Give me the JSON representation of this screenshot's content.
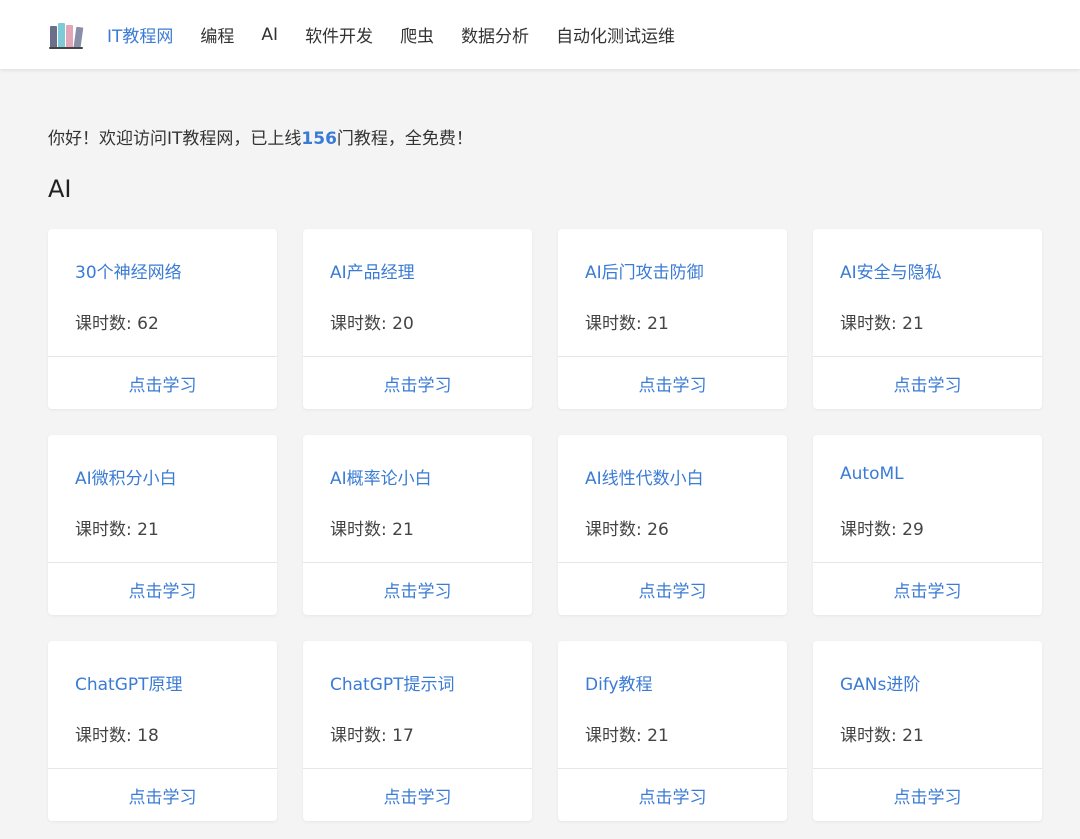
{
  "nav": {
    "logo_icon": "books-icon",
    "items": [
      {
        "label": "IT教程网",
        "active": true
      },
      {
        "label": "编程"
      },
      {
        "label": "AI"
      },
      {
        "label": "软件开发"
      },
      {
        "label": "爬虫"
      },
      {
        "label": "数据分析"
      },
      {
        "label": "自动化测试运维"
      }
    ]
  },
  "welcome": {
    "prefix": "你好！欢迎访问IT教程网，已上线",
    "count": "156",
    "suffix": "门教程，全免费！"
  },
  "section": {
    "title": "AI"
  },
  "cards": [
    {
      "title": "30个神经网络",
      "lessons": "课时数: 62",
      "action": "点击学习"
    },
    {
      "title": "AI产品经理",
      "lessons": "课时数: 20",
      "action": "点击学习"
    },
    {
      "title": "AI后门攻击防御",
      "lessons": "课时数: 21",
      "action": "点击学习"
    },
    {
      "title": "AI安全与隐私",
      "lessons": "课时数: 21",
      "action": "点击学习"
    },
    {
      "title": "AI微积分小白",
      "lessons": "课时数: 21",
      "action": "点击学习"
    },
    {
      "title": "AI概率论小白",
      "lessons": "课时数: 21",
      "action": "点击学习"
    },
    {
      "title": "AI线性代数小白",
      "lessons": "课时数: 26",
      "action": "点击学习"
    },
    {
      "title": "AutoML",
      "lessons": "课时数: 29",
      "action": "点击学习"
    },
    {
      "title": "ChatGPT原理",
      "lessons": "课时数: 18",
      "action": "点击学习"
    },
    {
      "title": "ChatGPT提示词",
      "lessons": "课时数: 17",
      "action": "点击学习"
    },
    {
      "title": "Dify教程",
      "lessons": "课时数: 21",
      "action": "点击学习"
    },
    {
      "title": "GANs进阶",
      "lessons": "课时数: 21",
      "action": "点击学习"
    }
  ],
  "colors": {
    "accent": "#3a7bd5",
    "background": "#f4f4f4",
    "card": "#ffffff"
  }
}
